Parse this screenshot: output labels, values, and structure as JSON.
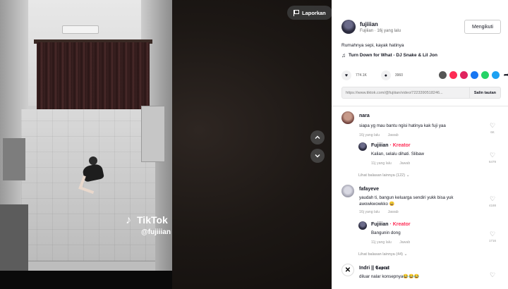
{
  "video": {
    "report_label": "Laporkan",
    "watermark_brand": "TikTok",
    "watermark_handle": "@fujiiian"
  },
  "post": {
    "author_name": "fujiiian",
    "author_meta": "Fujiiian · 16j yang lalu",
    "follow_label": "Mengikuti",
    "caption": "Rumahnya sepi, kayak hatinya",
    "music": "Turn Down for What - DJ Snake & Lil Jon",
    "likes": "774.1K",
    "comments_count": "3960",
    "link_url": "https://www.tiktok.com/@fujiiian/video/72233905182​46...",
    "copy_link_label": "Salin tautan"
  },
  "comments": [
    {
      "name": "nara",
      "text": "siapa yg mau bantu ngisi hatinya kak fuji yaa",
      "time": "16j yang lalu",
      "reply_label": "Jawab",
      "likes": "6K"
    },
    {
      "name": "Fujiiian",
      "badge": "· Kreator",
      "text": "Kalian, selalu dihati. Slibaw",
      "time": "11j yang lalu",
      "reply_label": "Jawab",
      "likes": "6479"
    },
    {
      "view_replies": "Lihat balasan lainnya (122)"
    },
    {
      "name": "fafayeve",
      "text": "yaudah ti, bangun keluarga sendiri yukk bisa yuk awowkwowkko 😀",
      "time": "16j yang lalu",
      "reply_label": "Jawab",
      "likes": "4188"
    },
    {
      "name": "Fujiiian",
      "badge": "· Kreator",
      "text": "Bangunin dong",
      "time": "11j yang lalu",
      "reply_label": "Jawab",
      "likes": "1716"
    },
    {
      "view_replies": "Lihat balasan lainnya (44)"
    },
    {
      "name": "Indri || 𝕮𝖆𝖕𝖈𝖚𝖙",
      "text": "diluar nalar konsepnya😂😂😂",
      "likes": ""
    }
  ]
}
